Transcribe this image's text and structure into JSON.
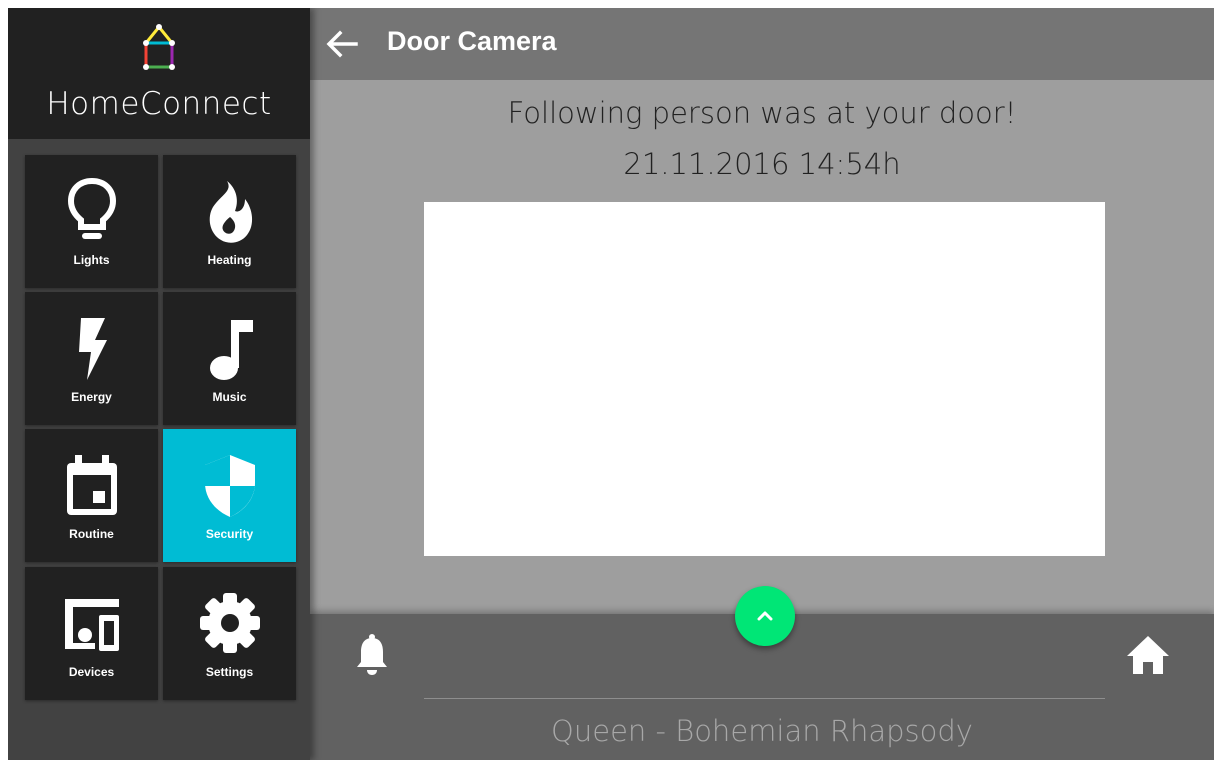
{
  "app": {
    "name": "HomeConnect"
  },
  "sidebar": {
    "items": [
      {
        "label": "Lights",
        "icon": "lightbulb-icon",
        "active": false
      },
      {
        "label": "Heating",
        "icon": "flame-icon",
        "active": false
      },
      {
        "label": "Energy",
        "icon": "lightning-bolt-icon",
        "active": false
      },
      {
        "label": "Music",
        "icon": "music-note-icon",
        "active": false
      },
      {
        "label": "Routine",
        "icon": "calendar-icon",
        "active": false
      },
      {
        "label": "Security",
        "icon": "shield-icon",
        "active": true
      },
      {
        "label": "Devices",
        "icon": "devices-icon",
        "active": false
      },
      {
        "label": "Settings",
        "icon": "gear-icon",
        "active": false
      }
    ]
  },
  "header": {
    "title": "Door Camera",
    "back_icon": "arrow-left-icon"
  },
  "main": {
    "message": "Following person was at your door!",
    "timestamp": "21.11.2016 14:54h"
  },
  "player": {
    "track": "Queen - Bohemian Rhapsody",
    "expand_icon": "chevron-up-icon",
    "left_icon": "bell-icon",
    "right_icon": "home-icon"
  },
  "colors": {
    "sidebar_bg": "#424242",
    "tile_bg": "#212121",
    "active_tile": "#00bcd4",
    "header_bg": "#757575",
    "content_bg": "#9e9e9e",
    "player_bg": "#616161",
    "fab": "#00e676"
  }
}
